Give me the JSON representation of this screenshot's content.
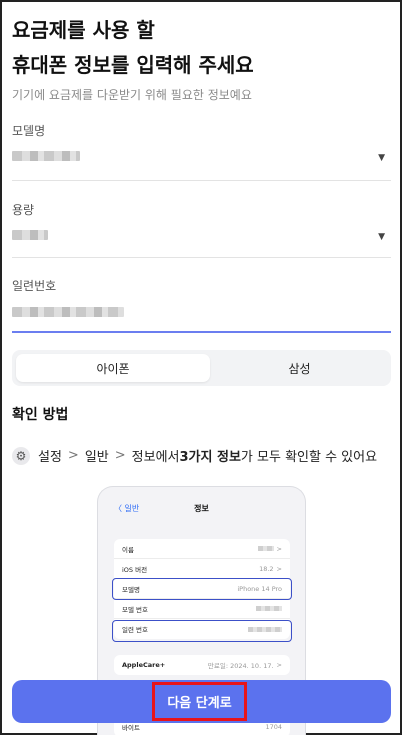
{
  "header": {
    "title_line1": "요금제를 사용 할",
    "title_line2": "휴대폰 정보를 입력해 주세요",
    "subtitle": "기기에 요금제를 다운받기 위해 필요한 정보예요"
  },
  "form": {
    "model": {
      "label": "모델명",
      "caret": "▼"
    },
    "capacity": {
      "label": "용량",
      "caret": "▼"
    },
    "serial": {
      "label": "일련번호"
    }
  },
  "segment": {
    "options": [
      "아이폰",
      "삼성"
    ],
    "selected": "아이폰"
  },
  "guide": {
    "title": "확인 방법",
    "step1": "설정",
    "chev": ">",
    "step2": "일반",
    "step3_pre": "정보에서 ",
    "step3_bold": "3가지 정보",
    "step3_post": "가 모두 확인할 수 있어요"
  },
  "phone_preview": {
    "back": "〈 일반",
    "title": "정보",
    "rows": [
      {
        "label": "이름",
        "value": ""
      },
      {
        "label": "iOS 버전",
        "value": "18.2"
      },
      {
        "label": "모델명",
        "value": "iPhone 14 Pro"
      },
      {
        "label": "모델 번호",
        "value": ""
      },
      {
        "label": "일련 번호",
        "value": ""
      }
    ],
    "applecare": {
      "label": "AppleCare+",
      "value": "만료일: 2024. 10. 17."
    },
    "bottom_row": {
      "label": "바이트",
      "value": "1704"
    }
  },
  "cta": {
    "label": "다음 단계로"
  },
  "colors": {
    "accent": "#5b72ee",
    "highlight": "#e8141b",
    "phone_highlight": "#3c50c8"
  }
}
